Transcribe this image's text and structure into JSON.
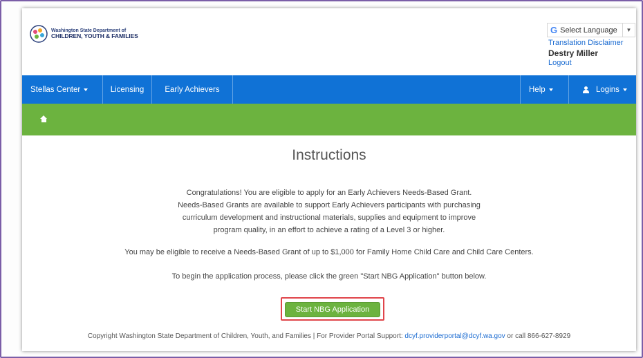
{
  "header": {
    "logo_line1": "Washington State Department of",
    "logo_line2": "CHILDREN, YOUTH & FAMILIES",
    "language_label": "Select Language",
    "language_caret": "▼",
    "google_icon": "G",
    "translation_disclaimer": "Translation Disclaimer",
    "user_name": "Destry Miller",
    "logout": "Logout"
  },
  "nav": {
    "items": [
      {
        "label": "Stellas Center"
      },
      {
        "label": "Licensing"
      },
      {
        "label": "Early Achievers"
      }
    ],
    "help": "Help",
    "logins": "Logins"
  },
  "breadcrumb": {
    "home_icon": "home-icon"
  },
  "main": {
    "title": "Instructions",
    "paragraph1": [
      "Congratulations! You are eligible to apply for an Early Achievers Needs-Based Grant.",
      "Needs-Based Grants are available to support Early Achievers participants with purchasing",
      "curriculum development and instructional materials, supplies and equipment to improve",
      "program quality, in an effort to achieve a rating of a Level 3 or higher."
    ],
    "paragraph2": "You may be eligible to receive a Needs-Based Grant of up to $1,000 for Family Home Child Care and Child Care Centers.",
    "paragraph3": "To begin the application process, please click the green \"Start NBG Application\" button below.",
    "start_button": "Start NBG Application"
  },
  "footer": {
    "text": "Copyright Washington State Department of Children, Youth, and Families | For Provider Portal Support: ",
    "email": "dcyf.providerportal@dcyf.wa.gov",
    "text_after": " or call 866-627-8929"
  },
  "colors": {
    "nav_blue": "#1072d6",
    "green": "#6cb33f",
    "highlight_red": "#e0454a",
    "link_blue": "#1a6bd1"
  }
}
